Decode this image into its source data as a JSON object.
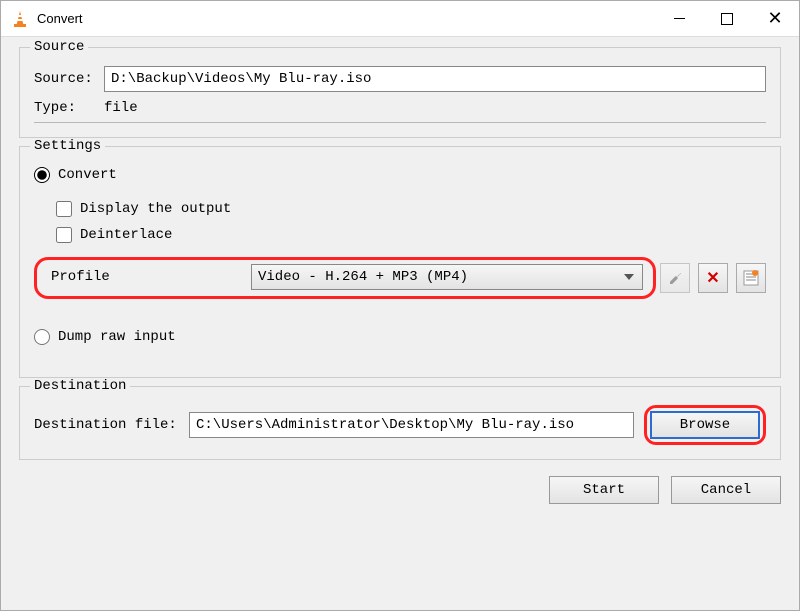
{
  "window": {
    "title": "Convert"
  },
  "source": {
    "legend": "Source",
    "source_label": "Source:",
    "source_value": "D:\\Backup\\Videos\\My Blu-ray.iso",
    "type_label": "Type:",
    "type_value": "file"
  },
  "settings": {
    "legend": "Settings",
    "convert_label": "Convert",
    "display_output_label": "Display the output",
    "deinterlace_label": "Deinterlace",
    "profile_label": "Profile",
    "profile_value": "Video - H.264 + MP3 (MP4)",
    "dump_label": "Dump raw input"
  },
  "destination": {
    "legend": "Destination",
    "file_label": "Destination file:",
    "file_value": "C:\\Users\\Administrator\\Desktop\\My Blu-ray.iso",
    "browse_label": "Browse"
  },
  "buttons": {
    "start": "Start",
    "cancel": "Cancel"
  }
}
